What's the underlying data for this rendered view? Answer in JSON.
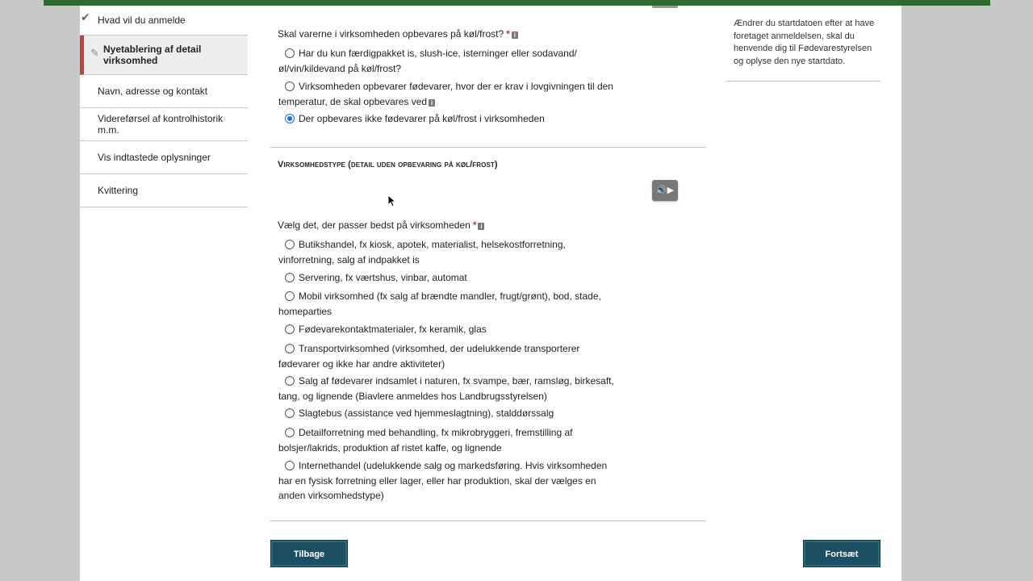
{
  "sidebar": {
    "items": [
      {
        "label": "Hvad vil du anmelde",
        "state": "done"
      },
      {
        "label": "Nyetablering af detail virksomhed",
        "state": "active"
      },
      {
        "label": "Navn, adresse og kontakt",
        "state": "normal"
      },
      {
        "label": "Videreførsel af kontrolhistorik m.m.",
        "state": "normal"
      },
      {
        "label": "Vis indtastede oplysninger",
        "state": "normal"
      },
      {
        "label": "Kvittering",
        "state": "normal"
      }
    ]
  },
  "cold_storage": {
    "question": "Skal varerne i virksomheden opbevares på køl/frost?",
    "required_mark": "*",
    "options": [
      {
        "label": "Har du kun færdigpakket is, slush-ice, isterninger eller sodavand/ øl/vin/kildevand på køl/frost?",
        "selected": false
      },
      {
        "label": "Virksomheden opbevarer fødevarer, hvor der er krav i lovgivningen til den temperatur, de skal opbevares ved",
        "selected": false
      },
      {
        "label": "Der opbevares ikke fødevarer på køl/frost i virksomheden",
        "selected": true
      }
    ]
  },
  "business_type": {
    "section_title": "Virksomhedstype (detail uden opbevaring på køl/frost)",
    "question": "Vælg det, der passer bedst på virksomheden",
    "required_mark": "*",
    "options": [
      {
        "label": "Butikshandel, fx kiosk, apotek, materialist, helsekostforretning, vinforretning, salg af indpakket is",
        "selected": false
      },
      {
        "label": "Servering, fx værtshus, vinbar, automat",
        "selected": false
      },
      {
        "label": "Mobil virksomhed (fx salg af brændte mandler, frugt/grønt), bod, stade, homeparties",
        "selected": false
      },
      {
        "label": "Fødevarekontaktmaterialer, fx keramik, glas",
        "selected": false
      },
      {
        "label": "Transportvirksomhed (virksomhed, der udelukkende transporterer fødevarer og ikke har andre aktiviteter)",
        "selected": false
      },
      {
        "label": "Salg af fødevarer indsamlet i naturen, fx svampe, bær, ramsløg, birkesaft, tang, og lignende (Biavlere anmeldes hos Landbrugsstyrelsen)",
        "selected": false
      },
      {
        "label": "Slagtebus (assistance ved hjemmeslagtning), stalddørssalg",
        "selected": false
      },
      {
        "label": "Detailforretning med behandling, fx mikrobryggeri, fremstilling af bolsjer/lakrids, produktion af ristet kaffe, og lignende",
        "selected": false
      },
      {
        "label": "Internethandel (udelukkende salg og markedsføring. Hvis virksomheden har en fysisk forretning eller lager, eller har produktion, skal der vælges en anden virksomhedstype)",
        "selected": false
      }
    ]
  },
  "buttons": {
    "back": "Tilbage",
    "continue": "Fortsæt"
  },
  "aside": {
    "text": "Ændrer du startdatoen efter at have foretaget anmeldelsen, skal du henvende dig til Fødevarestyrelsen og oplyse den nye startdato."
  },
  "icons": {
    "info": "info-icon",
    "audio": "audio-play-icon",
    "check": "checkmark-icon",
    "edit": "pencil-icon"
  },
  "colors": {
    "top_bar": "#2f6b2f",
    "button": "#1d4f63",
    "active_marker": "#c0413d",
    "radio_selected": "#1a73e8"
  }
}
